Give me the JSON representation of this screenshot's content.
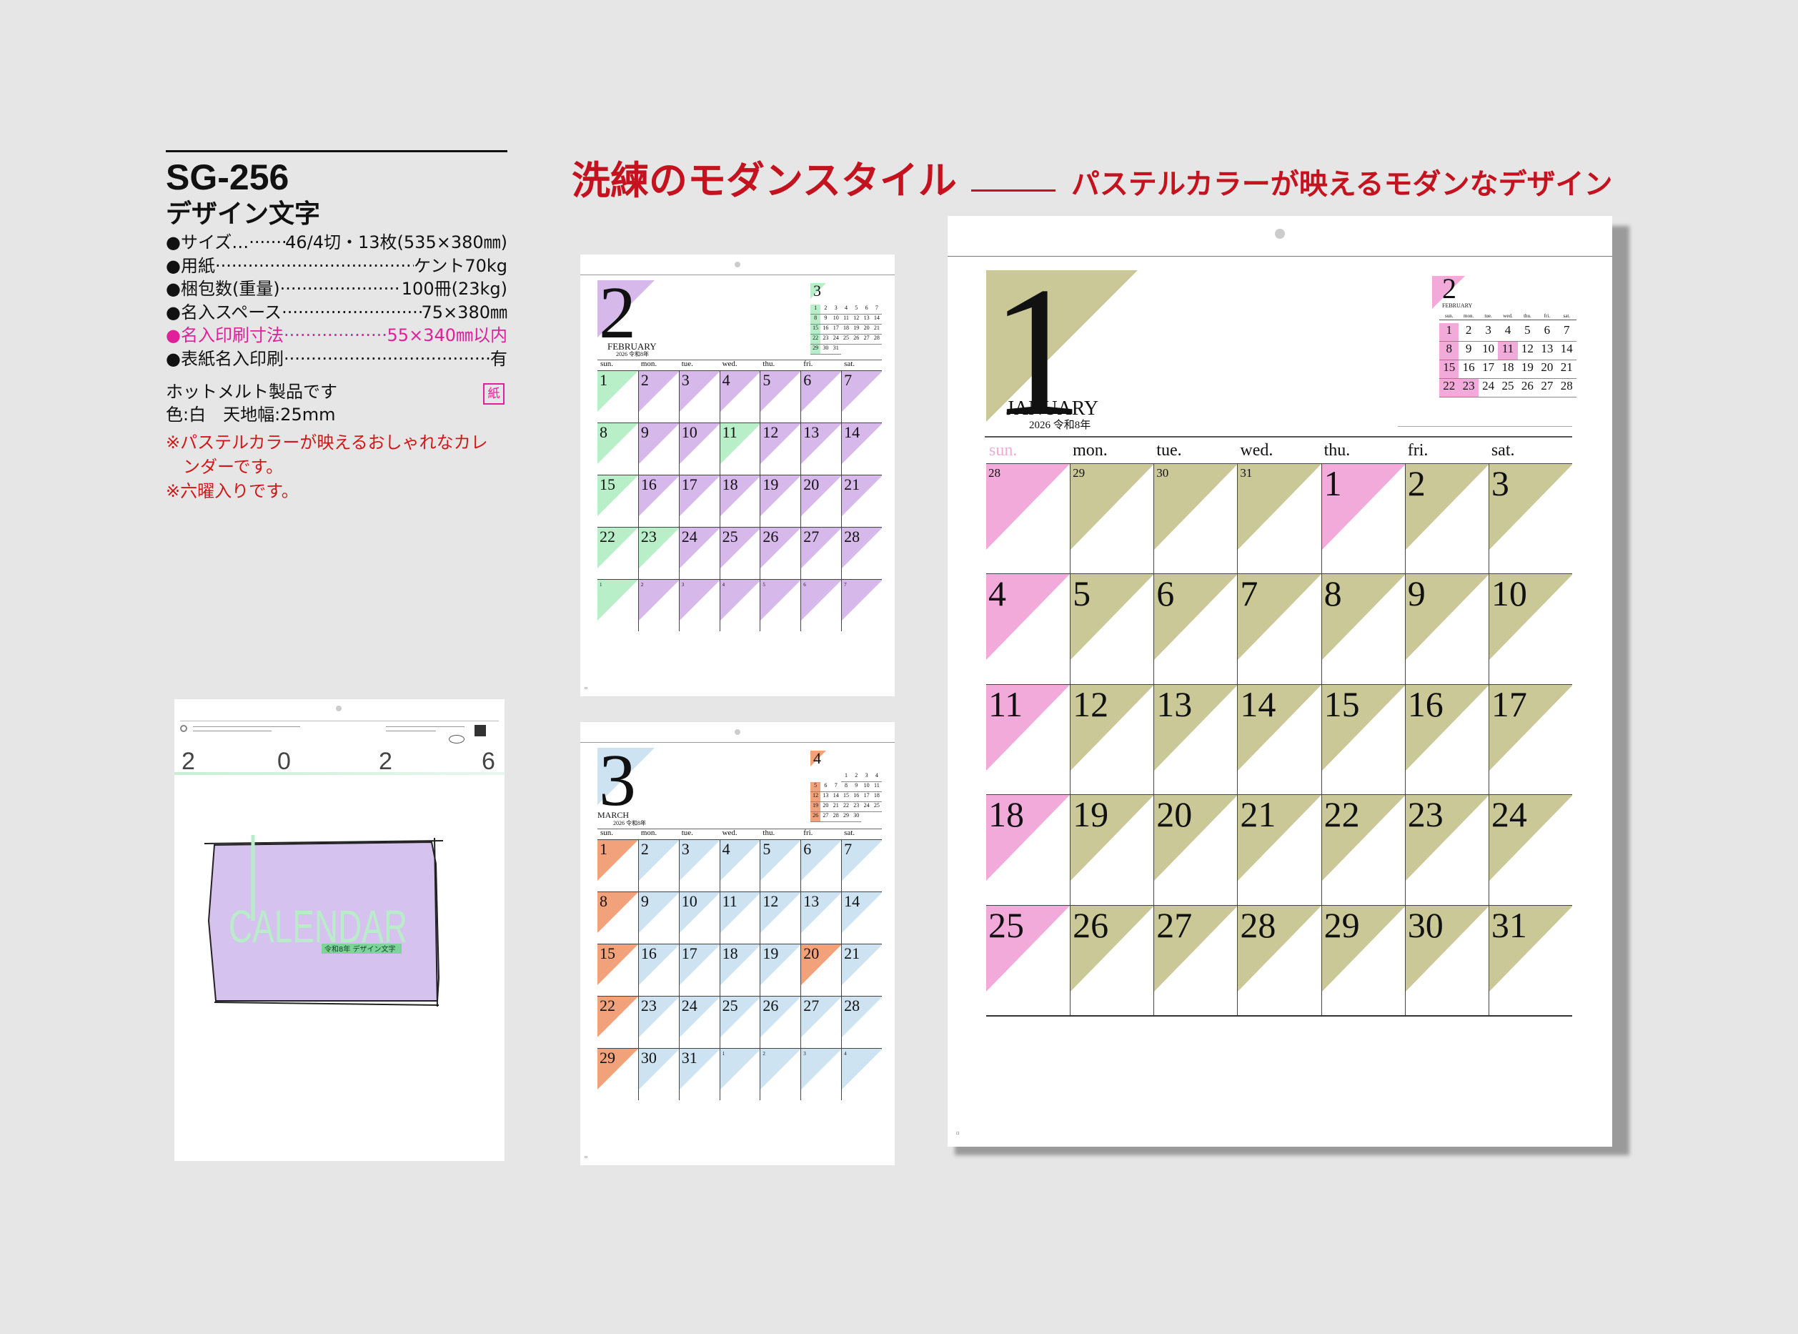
{
  "spec": {
    "code": "SG-256",
    "name": "デザイン文字",
    "rows": [
      {
        "label": "●サイズ…",
        "value": " 46/4切・13枚(535×380㎜)",
        "pink": false
      },
      {
        "label": "●用紙",
        "value": "ケント70kg",
        "pink": false
      },
      {
        "label": "●梱包数(重量)",
        "value": "100冊(23kg)",
        "pink": false
      },
      {
        "label": "●名入スペース",
        "value": "75×380㎜",
        "pink": false
      },
      {
        "label": "●名入印刷寸法",
        "value": "55×340㎜以内",
        "pink": true
      },
      {
        "label": "●表紙名入印刷",
        "value": "有",
        "pink": false
      }
    ],
    "note_hotmelt": "ホットメルト製品です",
    "paper_badge": "紙",
    "note_color": "色:白　天地幅:25mm",
    "notes_red": [
      "※パステルカラーが映えるおしゃれなカレ",
      "　ンダーです。",
      "※六曜入りです。"
    ]
  },
  "headline": {
    "main": "洗練のモダンスタイル",
    "sub": "パステルカラーが映えるモダンなデザイン"
  },
  "cover": {
    "year_digits": [
      "2",
      "0",
      "2",
      "6"
    ],
    "word": "CALENDAR",
    "label": "令和8年 デザイン文字",
    "purple": "#d6c2ee",
    "mint": "#b9ecc9"
  },
  "colors": {
    "olive": "#cbc897",
    "pink": "#f2aadb",
    "purple": "#d6b8ea",
    "mint": "#b8efc8",
    "blue": "#cde3f1",
    "orange": "#f2a27a",
    "green_text": "#2a8a45"
  },
  "january": {
    "month_number": "1",
    "month_name": "JANUARY",
    "year_line": "2026 令和8年",
    "weekdays": [
      "sun.",
      "mon.",
      "tue.",
      "wed.",
      "thu.",
      "fri.",
      "sat."
    ],
    "days": [
      "28",
      "29",
      "30",
      "31",
      "1",
      "2",
      "3",
      "4",
      "5",
      "6",
      "7",
      "8",
      "9",
      "10",
      "11",
      "12",
      "13",
      "14",
      "15",
      "16",
      "17",
      "18",
      "19",
      "20",
      "21",
      "22",
      "23",
      "24",
      "25",
      "26",
      "27",
      "28",
      "29",
      "30",
      "31"
    ],
    "holidays": [
      "1",
      "12"
    ],
    "next_month": {
      "number": "2",
      "name": "FEBRUARY",
      "weekdays": [
        "sun.",
        "mon.",
        "tue.",
        "wed.",
        "thu.",
        "fri.",
        "sat."
      ],
      "days": [
        "1",
        "2",
        "3",
        "4",
        "5",
        "6",
        "7",
        "8",
        "9",
        "10",
        "11",
        "12",
        "13",
        "14",
        "15",
        "16",
        "17",
        "18",
        "19",
        "20",
        "21",
        "22",
        "23",
        "24",
        "25",
        "26",
        "27",
        "28"
      ],
      "marked": [
        "11",
        "23"
      ]
    }
  },
  "february": {
    "month_number": "2",
    "month_name": "FEBRUARY",
    "year_line": "2026 令和8年",
    "weekdays": [
      "sun.",
      "mon.",
      "tue.",
      "wed.",
      "thu.",
      "fri.",
      "sat."
    ],
    "days": [
      "1",
      "2",
      "3",
      "4",
      "5",
      "6",
      "7",
      "8",
      "9",
      "10",
      "11",
      "12",
      "13",
      "14",
      "15",
      "16",
      "17",
      "18",
      "19",
      "20",
      "21",
      "22",
      "23",
      "24",
      "25",
      "26",
      "27",
      "28",
      "1",
      "2",
      "3",
      "4",
      "5",
      "6",
      "7"
    ],
    "holidays": [
      "11",
      "23"
    ],
    "mini_number": "3",
    "mini_days": [
      "1",
      "2",
      "3",
      "4",
      "5",
      "6",
      "7",
      "8",
      "9",
      "10",
      "11",
      "12",
      "13",
      "14",
      "15",
      "16",
      "17",
      "18",
      "19",
      "20",
      "21",
      "22",
      "23",
      "24",
      "25",
      "26",
      "27",
      "28",
      "29",
      "30",
      "31"
    ]
  },
  "march": {
    "month_number": "3",
    "month_name": "MARCH",
    "year_line": "2026 令和8年",
    "weekdays": [
      "sun.",
      "mon.",
      "tue.",
      "wed.",
      "thu.",
      "fri.",
      "sat."
    ],
    "days": [
      "1",
      "2",
      "3",
      "4",
      "5",
      "6",
      "7",
      "8",
      "9",
      "10",
      "11",
      "12",
      "13",
      "14",
      "15",
      "16",
      "17",
      "18",
      "19",
      "20",
      "21",
      "22",
      "23",
      "24",
      "25",
      "26",
      "27",
      "28",
      "29",
      "30",
      "31",
      "1",
      "2",
      "3",
      "4"
    ],
    "holidays": [
      "20"
    ],
    "mini_number": "4",
    "mini_days": [
      "1",
      "2",
      "3",
      "4",
      "5",
      "6",
      "7",
      "8",
      "9",
      "10",
      "11",
      "12",
      "13",
      "14",
      "15",
      "16",
      "17",
      "18",
      "19",
      "20",
      "21",
      "22",
      "23",
      "24",
      "25",
      "26",
      "27",
      "28",
      "29",
      "30"
    ]
  }
}
